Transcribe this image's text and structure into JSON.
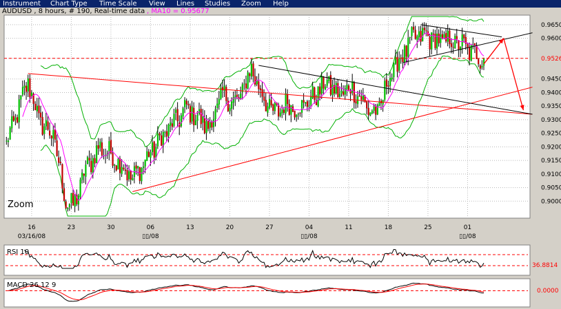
{
  "menu": [
    "Instrument",
    "Chart Type",
    "Time Scale",
    "View",
    "Lines",
    "Studies",
    "Zoom",
    "Help"
  ],
  "colors": {
    "menubar": "#0a246a",
    "panel_bg": "#ffffff",
    "up_candle": "#00c000",
    "down_candle": "#c00000",
    "ma": "#ff00ff",
    "bollinger": "#00b000",
    "trendline_red": "#ff0000",
    "trendline_black": "#000000",
    "grid": "#b8b8b8"
  },
  "chart_data": [
    {
      "type": "candlestick",
      "title": "AUDUSD , 8 hours, # 190, Real-time data",
      "indicator_label": ", MA10 = 0.95677",
      "overlay_text": "Zoom",
      "price_label": "0.9526",
      "ylim": [
        0.8945,
        0.968
      ],
      "y_ticks": [
        "0.9650",
        "0.9600",
        "0.9526",
        "0.9450",
        "0.9400",
        "0.9350",
        "0.9300",
        "0.9250",
        "0.9200",
        "0.9150",
        "0.9100",
        "0.9050",
        "0.9000"
      ],
      "x_ticks": [
        "16",
        "23",
        "30",
        "06",
        "13",
        "20",
        "27",
        "04",
        "11",
        "18",
        "25",
        "01"
      ],
      "x_tick_index": [
        14,
        36,
        58,
        80,
        102,
        124,
        146,
        168,
        190,
        212,
        234,
        256
      ],
      "x_sublabels": [
        {
          "text": "03/16/08",
          "index": 14
        },
        {
          "text": "▯▯/08",
          "index": 80
        },
        {
          "text": "▯▯/08",
          "index": 168
        },
        {
          "text": "▯▯/08",
          "index": 256
        }
      ],
      "n_candles": 266,
      "close_anchors": [
        [
          0,
          0.921
        ],
        [
          12,
          0.944
        ],
        [
          18,
          0.93
        ],
        [
          26,
          0.924
        ],
        [
          33,
          0.9
        ],
        [
          37,
          0.8975
        ],
        [
          44,
          0.912
        ],
        [
          52,
          0.92
        ],
        [
          62,
          0.915
        ],
        [
          70,
          0.908
        ],
        [
          78,
          0.916
        ],
        [
          88,
          0.925
        ],
        [
          100,
          0.934
        ],
        [
          106,
          0.931
        ],
        [
          112,
          0.927
        ],
        [
          120,
          0.939
        ],
        [
          128,
          0.936
        ],
        [
          136,
          0.949
        ],
        [
          140,
          0.942
        ],
        [
          148,
          0.932
        ],
        [
          156,
          0.936
        ],
        [
          162,
          0.934
        ],
        [
          170,
          0.938
        ],
        [
          178,
          0.944
        ],
        [
          184,
          0.939
        ],
        [
          192,
          0.942
        ],
        [
          200,
          0.9345
        ],
        [
          206,
          0.932
        ],
        [
          212,
          0.945
        ],
        [
          218,
          0.952
        ],
        [
          226,
          0.96
        ],
        [
          232,
          0.961
        ],
        [
          240,
          0.959
        ],
        [
          248,
          0.959
        ],
        [
          254,
          0.957
        ],
        [
          260,
          0.954
        ],
        [
          265,
          0.9526
        ]
      ],
      "ma_period": 10,
      "bollinger_period": 20,
      "bollinger_k": 2,
      "hlines": [
        {
          "price": 0.9526,
          "style": "dashed",
          "color": "#ff0000"
        }
      ],
      "trendlines": [
        {
          "color": "#ff0000",
          "from": [
            12,
            0.947
          ],
          "to": [
            292,
            0.932
          ]
        },
        {
          "color": "#ff0000",
          "from": [
            70,
            0.9035
          ],
          "to": [
            292,
            0.942
          ]
        },
        {
          "color": "#000000",
          "from": [
            140,
            0.95
          ],
          "to": [
            292,
            0.932
          ]
        },
        {
          "color": "#000000",
          "from": [
            220,
            0.951
          ],
          "to": [
            292,
            0.962
          ]
        },
        {
          "color": "#000000",
          "from": [
            230,
            0.965
          ],
          "to": [
            275,
            0.9605
          ]
        }
      ],
      "arrows": [
        {
          "color": "#ff0000",
          "from": [
            265,
            0.9505
          ],
          "to": [
            276,
            0.96
          ]
        },
        {
          "color": "#ff0000",
          "from": [
            276,
            0.96
          ],
          "to": [
            287,
            0.9335
          ]
        }
      ]
    },
    {
      "type": "line",
      "title": "RSI 10",
      "value_label": "36.8814",
      "ylim": [
        0,
        100
      ],
      "dashed_levels": [
        70,
        30
      ]
    },
    {
      "type": "line",
      "title": "MACD 26 12 9",
      "value_label": "0.0000",
      "dashed_levels": [
        0
      ]
    }
  ]
}
